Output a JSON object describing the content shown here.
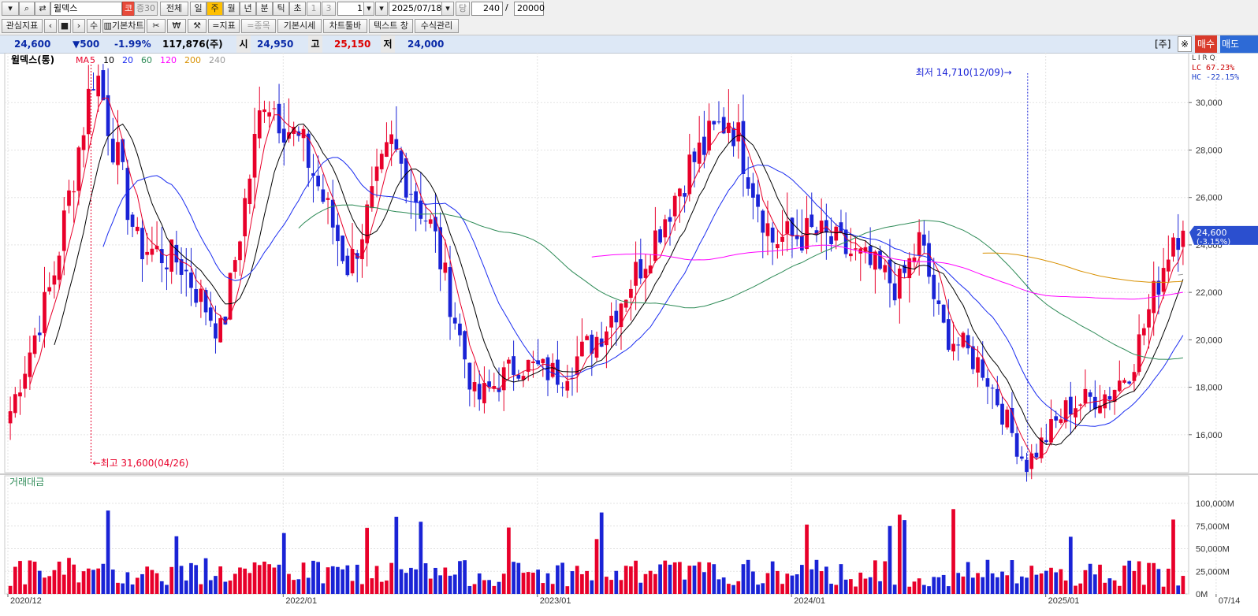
{
  "toolbar1": {
    "stock_name": "윌덱스",
    "market_badge": "코",
    "credit_badge": "증30",
    "btn_all": "전체",
    "periods": [
      "일",
      "주",
      "월",
      "년",
      "분",
      "틱",
      "초"
    ],
    "selected_period": "주",
    "num1": "1",
    "num3": "3",
    "count": "1",
    "date": "2025/07/18",
    "dang": "당",
    "bars": "240",
    "slash": "/",
    "max_bars": "20000"
  },
  "toolbar2": {
    "items": [
      "관심지표",
      "수",
      "기본차트",
      "₩",
      "=지표",
      "=종목",
      "기본시세",
      "차트툴바",
      "텍스트 창",
      "수식관리"
    ]
  },
  "quote": {
    "price": "24,600",
    "change": "▼500",
    "change_pct": "-1.99%",
    "volume": "117,876(주)",
    "open_label": "시",
    "open": "24,950",
    "high_label": "고",
    "high": "25,150",
    "low_label": "저",
    "low": "24,000",
    "right_btn1": "[주]",
    "right_btn2": "※",
    "buy": "매수",
    "sell": "매도"
  },
  "price_panel": {
    "title": "윌덱스(통)",
    "ma_label": "MA",
    "ma_periods": [
      "5",
      "10",
      "20",
      "60",
      "120",
      "200",
      "240"
    ],
    "ma_colors": [
      "#e8002a",
      "#000000",
      "#1a2cf0",
      "#2e8b57",
      "#ff00ff",
      "#d89000",
      "#999999"
    ],
    "lirq": "L I R Q",
    "lc": "LC  67.23%",
    "hc": "HC -22.15%",
    "max_annotation": "최고 31,600(04/26)",
    "min_annotation": "최저 14,710(12/09)",
    "current_tag": "24,600",
    "current_pct": "(-3.15%)",
    "y_ticks": [
      "30,000",
      "28,000",
      "26,000",
      "24,000",
      "22,000",
      "20,000",
      "18,000",
      "16,000"
    ],
    "y_min": 14400,
    "y_max": 32100
  },
  "volume_panel": {
    "title": "거래대금",
    "y_ticks": [
      "100,000M",
      "75,000M",
      "50,000M",
      "25,000M",
      "0M"
    ],
    "y_max": 120000
  },
  "x_axis": {
    "labels": [
      "2020/12",
      "2022/01",
      "2023/01",
      "2024/01",
      "2025/01",
      "07/14"
    ]
  },
  "colors": {
    "up": "#e8002a",
    "down": "#1a23d6",
    "grid": "#e3e3e3",
    "info_bg": "#dde8f6",
    "selected_period": "#ffc000"
  },
  "chart_data": {
    "type": "candlestick",
    "timeframe": "weekly",
    "date_range": [
      "2020/12",
      "2025/07"
    ],
    "anchor_points": [
      {
        "date": "2020/12",
        "price": 17000
      },
      {
        "date": "2021/02",
        "price": 22500
      },
      {
        "date": "2021/04",
        "price": 31600
      },
      {
        "date": "2021/06",
        "price": 24000
      },
      {
        "date": "2021/08",
        "price": 23300
      },
      {
        "date": "2021/10",
        "price": 20200
      },
      {
        "date": "2021/12",
        "price": 30500
      },
      {
        "date": "2022/02",
        "price": 27800
      },
      {
        "date": "2022/04",
        "price": 23000
      },
      {
        "date": "2022/06",
        "price": 28200
      },
      {
        "date": "2022/08",
        "price": 24500
      },
      {
        "date": "2022/10",
        "price": 17400
      },
      {
        "date": "2022/12",
        "price": 19000
      },
      {
        "date": "2023/02",
        "price": 18500
      },
      {
        "date": "2023/04",
        "price": 20400
      },
      {
        "date": "2023/06",
        "price": 23500
      },
      {
        "date": "2023/08",
        "price": 27200
      },
      {
        "date": "2023/10",
        "price": 29500
      },
      {
        "date": "2023/12",
        "price": 24200
      },
      {
        "date": "2024/02",
        "price": 24500
      },
      {
        "date": "2024/04",
        "price": 23500
      },
      {
        "date": "2024/06",
        "price": 22200
      },
      {
        "date": "2024/07",
        "price": 24200
      },
      {
        "date": "2024/08",
        "price": 20500
      },
      {
        "date": "2024/10",
        "price": 18800
      },
      {
        "date": "2024/12",
        "price": 14710
      },
      {
        "date": "2025/02",
        "price": 17200
      },
      {
        "date": "2025/04",
        "price": 17800
      },
      {
        "date": "2025/05",
        "price": 18900
      },
      {
        "date": "2025/07",
        "price": 24600
      }
    ],
    "extremes": {
      "max": 31600,
      "max_date": "04/26",
      "min": 14710,
      "min_date": "12/09"
    },
    "moving_averages": [
      5,
      10,
      20,
      60,
      120,
      200,
      240
    ],
    "ylim": [
      14400,
      32100
    ],
    "volume_series_name": "거래대금",
    "volume_ylim": [
      0,
      120000
    ]
  }
}
